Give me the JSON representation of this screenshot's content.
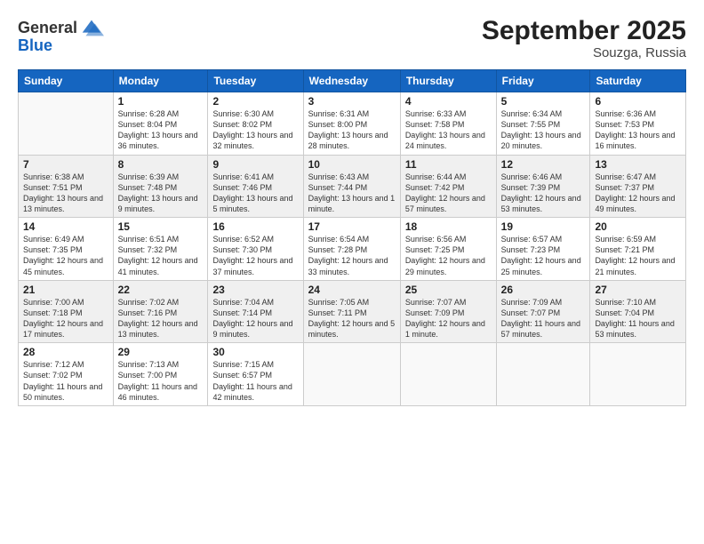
{
  "logo": {
    "general": "General",
    "blue": "Blue"
  },
  "header": {
    "month": "September 2025",
    "location": "Souzga, Russia"
  },
  "weekdays": [
    "Sunday",
    "Monday",
    "Tuesday",
    "Wednesday",
    "Thursday",
    "Friday",
    "Saturday"
  ],
  "weeks": [
    [
      {
        "day": "",
        "empty": true
      },
      {
        "day": "1",
        "sunrise": "6:28 AM",
        "sunset": "8:04 PM",
        "daylight": "13 hours and 36 minutes."
      },
      {
        "day": "2",
        "sunrise": "6:30 AM",
        "sunset": "8:02 PM",
        "daylight": "13 hours and 32 minutes."
      },
      {
        "day": "3",
        "sunrise": "6:31 AM",
        "sunset": "8:00 PM",
        "daylight": "13 hours and 28 minutes."
      },
      {
        "day": "4",
        "sunrise": "6:33 AM",
        "sunset": "7:58 PM",
        "daylight": "13 hours and 24 minutes."
      },
      {
        "day": "5",
        "sunrise": "6:34 AM",
        "sunset": "7:55 PM",
        "daylight": "13 hours and 20 minutes."
      },
      {
        "day": "6",
        "sunrise": "6:36 AM",
        "sunset": "7:53 PM",
        "daylight": "13 hours and 16 minutes."
      }
    ],
    [
      {
        "day": "7",
        "sunrise": "6:38 AM",
        "sunset": "7:51 PM",
        "daylight": "13 hours and 13 minutes."
      },
      {
        "day": "8",
        "sunrise": "6:39 AM",
        "sunset": "7:48 PM",
        "daylight": "13 hours and 9 minutes."
      },
      {
        "day": "9",
        "sunrise": "6:41 AM",
        "sunset": "7:46 PM",
        "daylight": "13 hours and 5 minutes."
      },
      {
        "day": "10",
        "sunrise": "6:43 AM",
        "sunset": "7:44 PM",
        "daylight": "13 hours and 1 minute."
      },
      {
        "day": "11",
        "sunrise": "6:44 AM",
        "sunset": "7:42 PM",
        "daylight": "12 hours and 57 minutes."
      },
      {
        "day": "12",
        "sunrise": "6:46 AM",
        "sunset": "7:39 PM",
        "daylight": "12 hours and 53 minutes."
      },
      {
        "day": "13",
        "sunrise": "6:47 AM",
        "sunset": "7:37 PM",
        "daylight": "12 hours and 49 minutes."
      }
    ],
    [
      {
        "day": "14",
        "sunrise": "6:49 AM",
        "sunset": "7:35 PM",
        "daylight": "12 hours and 45 minutes."
      },
      {
        "day": "15",
        "sunrise": "6:51 AM",
        "sunset": "7:32 PM",
        "daylight": "12 hours and 41 minutes."
      },
      {
        "day": "16",
        "sunrise": "6:52 AM",
        "sunset": "7:30 PM",
        "daylight": "12 hours and 37 minutes."
      },
      {
        "day": "17",
        "sunrise": "6:54 AM",
        "sunset": "7:28 PM",
        "daylight": "12 hours and 33 minutes."
      },
      {
        "day": "18",
        "sunrise": "6:56 AM",
        "sunset": "7:25 PM",
        "daylight": "12 hours and 29 minutes."
      },
      {
        "day": "19",
        "sunrise": "6:57 AM",
        "sunset": "7:23 PM",
        "daylight": "12 hours and 25 minutes."
      },
      {
        "day": "20",
        "sunrise": "6:59 AM",
        "sunset": "7:21 PM",
        "daylight": "12 hours and 21 minutes."
      }
    ],
    [
      {
        "day": "21",
        "sunrise": "7:00 AM",
        "sunset": "7:18 PM",
        "daylight": "12 hours and 17 minutes."
      },
      {
        "day": "22",
        "sunrise": "7:02 AM",
        "sunset": "7:16 PM",
        "daylight": "12 hours and 13 minutes."
      },
      {
        "day": "23",
        "sunrise": "7:04 AM",
        "sunset": "7:14 PM",
        "daylight": "12 hours and 9 minutes."
      },
      {
        "day": "24",
        "sunrise": "7:05 AM",
        "sunset": "7:11 PM",
        "daylight": "12 hours and 5 minutes."
      },
      {
        "day": "25",
        "sunrise": "7:07 AM",
        "sunset": "7:09 PM",
        "daylight": "12 hours and 1 minute."
      },
      {
        "day": "26",
        "sunrise": "7:09 AM",
        "sunset": "7:07 PM",
        "daylight": "11 hours and 57 minutes."
      },
      {
        "day": "27",
        "sunrise": "7:10 AM",
        "sunset": "7:04 PM",
        "daylight": "11 hours and 53 minutes."
      }
    ],
    [
      {
        "day": "28",
        "sunrise": "7:12 AM",
        "sunset": "7:02 PM",
        "daylight": "11 hours and 50 minutes."
      },
      {
        "day": "29",
        "sunrise": "7:13 AM",
        "sunset": "7:00 PM",
        "daylight": "11 hours and 46 minutes."
      },
      {
        "day": "30",
        "sunrise": "7:15 AM",
        "sunset": "6:57 PM",
        "daylight": "11 hours and 42 minutes."
      },
      {
        "day": "",
        "empty": true
      },
      {
        "day": "",
        "empty": true
      },
      {
        "day": "",
        "empty": true
      },
      {
        "day": "",
        "empty": true
      }
    ]
  ],
  "labels": {
    "sunrise": "Sunrise:",
    "sunset": "Sunset:",
    "daylight": "Daylight:"
  }
}
